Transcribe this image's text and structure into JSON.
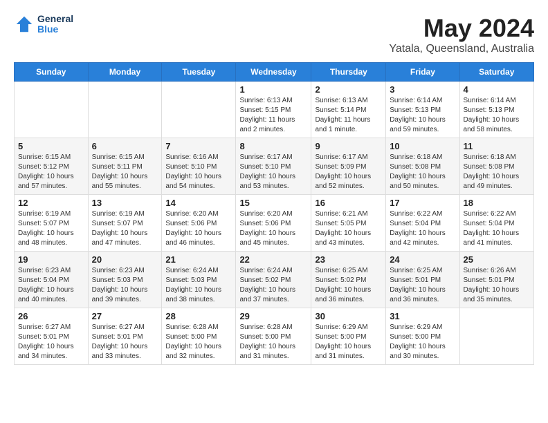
{
  "header": {
    "logo_line1": "General",
    "logo_line2": "Blue",
    "month_title": "May 2024",
    "location": "Yatala, Queensland, Australia"
  },
  "weekdays": [
    "Sunday",
    "Monday",
    "Tuesday",
    "Wednesday",
    "Thursday",
    "Friday",
    "Saturday"
  ],
  "weeks": [
    [
      {
        "day": "",
        "info": ""
      },
      {
        "day": "",
        "info": ""
      },
      {
        "day": "",
        "info": ""
      },
      {
        "day": "1",
        "info": "Sunrise: 6:13 AM\nSunset: 5:15 PM\nDaylight: 11 hours\nand 2 minutes."
      },
      {
        "day": "2",
        "info": "Sunrise: 6:13 AM\nSunset: 5:14 PM\nDaylight: 11 hours\nand 1 minute."
      },
      {
        "day": "3",
        "info": "Sunrise: 6:14 AM\nSunset: 5:13 PM\nDaylight: 10 hours\nand 59 minutes."
      },
      {
        "day": "4",
        "info": "Sunrise: 6:14 AM\nSunset: 5:13 PM\nDaylight: 10 hours\nand 58 minutes."
      }
    ],
    [
      {
        "day": "5",
        "info": "Sunrise: 6:15 AM\nSunset: 5:12 PM\nDaylight: 10 hours\nand 57 minutes."
      },
      {
        "day": "6",
        "info": "Sunrise: 6:15 AM\nSunset: 5:11 PM\nDaylight: 10 hours\nand 55 minutes."
      },
      {
        "day": "7",
        "info": "Sunrise: 6:16 AM\nSunset: 5:10 PM\nDaylight: 10 hours\nand 54 minutes."
      },
      {
        "day": "8",
        "info": "Sunrise: 6:17 AM\nSunset: 5:10 PM\nDaylight: 10 hours\nand 53 minutes."
      },
      {
        "day": "9",
        "info": "Sunrise: 6:17 AM\nSunset: 5:09 PM\nDaylight: 10 hours\nand 52 minutes."
      },
      {
        "day": "10",
        "info": "Sunrise: 6:18 AM\nSunset: 5:08 PM\nDaylight: 10 hours\nand 50 minutes."
      },
      {
        "day": "11",
        "info": "Sunrise: 6:18 AM\nSunset: 5:08 PM\nDaylight: 10 hours\nand 49 minutes."
      }
    ],
    [
      {
        "day": "12",
        "info": "Sunrise: 6:19 AM\nSunset: 5:07 PM\nDaylight: 10 hours\nand 48 minutes."
      },
      {
        "day": "13",
        "info": "Sunrise: 6:19 AM\nSunset: 5:07 PM\nDaylight: 10 hours\nand 47 minutes."
      },
      {
        "day": "14",
        "info": "Sunrise: 6:20 AM\nSunset: 5:06 PM\nDaylight: 10 hours\nand 46 minutes."
      },
      {
        "day": "15",
        "info": "Sunrise: 6:20 AM\nSunset: 5:06 PM\nDaylight: 10 hours\nand 45 minutes."
      },
      {
        "day": "16",
        "info": "Sunrise: 6:21 AM\nSunset: 5:05 PM\nDaylight: 10 hours\nand 43 minutes."
      },
      {
        "day": "17",
        "info": "Sunrise: 6:22 AM\nSunset: 5:04 PM\nDaylight: 10 hours\nand 42 minutes."
      },
      {
        "day": "18",
        "info": "Sunrise: 6:22 AM\nSunset: 5:04 PM\nDaylight: 10 hours\nand 41 minutes."
      }
    ],
    [
      {
        "day": "19",
        "info": "Sunrise: 6:23 AM\nSunset: 5:04 PM\nDaylight: 10 hours\nand 40 minutes."
      },
      {
        "day": "20",
        "info": "Sunrise: 6:23 AM\nSunset: 5:03 PM\nDaylight: 10 hours\nand 39 minutes."
      },
      {
        "day": "21",
        "info": "Sunrise: 6:24 AM\nSunset: 5:03 PM\nDaylight: 10 hours\nand 38 minutes."
      },
      {
        "day": "22",
        "info": "Sunrise: 6:24 AM\nSunset: 5:02 PM\nDaylight: 10 hours\nand 37 minutes."
      },
      {
        "day": "23",
        "info": "Sunrise: 6:25 AM\nSunset: 5:02 PM\nDaylight: 10 hours\nand 36 minutes."
      },
      {
        "day": "24",
        "info": "Sunrise: 6:25 AM\nSunset: 5:01 PM\nDaylight: 10 hours\nand 36 minutes."
      },
      {
        "day": "25",
        "info": "Sunrise: 6:26 AM\nSunset: 5:01 PM\nDaylight: 10 hours\nand 35 minutes."
      }
    ],
    [
      {
        "day": "26",
        "info": "Sunrise: 6:27 AM\nSunset: 5:01 PM\nDaylight: 10 hours\nand 34 minutes."
      },
      {
        "day": "27",
        "info": "Sunrise: 6:27 AM\nSunset: 5:01 PM\nDaylight: 10 hours\nand 33 minutes."
      },
      {
        "day": "28",
        "info": "Sunrise: 6:28 AM\nSunset: 5:00 PM\nDaylight: 10 hours\nand 32 minutes."
      },
      {
        "day": "29",
        "info": "Sunrise: 6:28 AM\nSunset: 5:00 PM\nDaylight: 10 hours\nand 31 minutes."
      },
      {
        "day": "30",
        "info": "Sunrise: 6:29 AM\nSunset: 5:00 PM\nDaylight: 10 hours\nand 31 minutes."
      },
      {
        "day": "31",
        "info": "Sunrise: 6:29 AM\nSunset: 5:00 PM\nDaylight: 10 hours\nand 30 minutes."
      },
      {
        "day": "",
        "info": ""
      }
    ]
  ]
}
